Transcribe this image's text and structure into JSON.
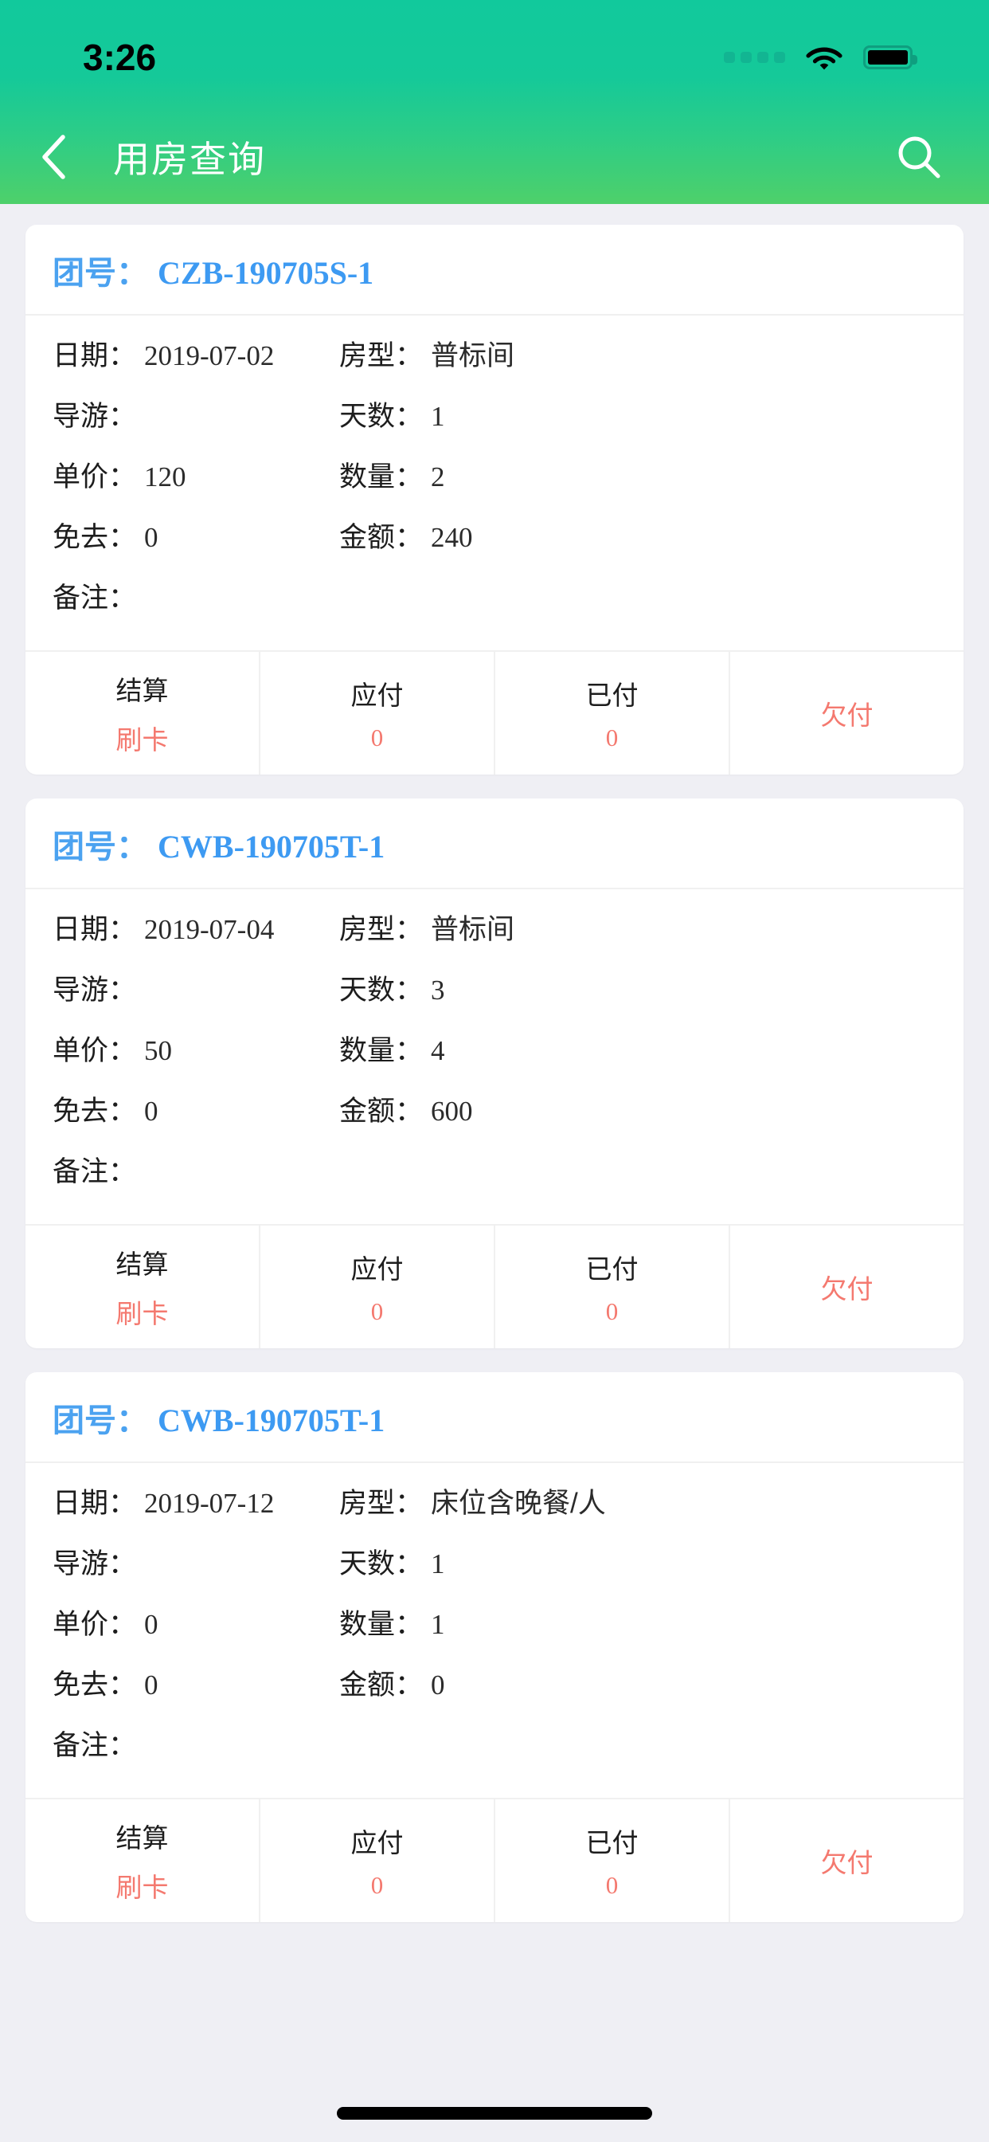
{
  "status_bar": {
    "time": "3:26",
    "signal_icon": "signal-dots-icon",
    "wifi_icon": "wifi-icon",
    "battery_icon": "battery-full-icon"
  },
  "nav": {
    "back_icon": "chevron-left-icon",
    "title": "用房查询",
    "search_icon": "search-icon"
  },
  "theme": {
    "header_gradient_start": "#11c99c",
    "header_gradient_end": "#4ed06a",
    "page_background": "#efeff4",
    "card_background": "#ffffff",
    "group_no_color": "#4ba2f0",
    "accent_red": "#f4796f",
    "text_primary": "#1d1d1d",
    "divider": "#f0f0f0"
  },
  "labels": {
    "group_no": "团号：",
    "date": "日期：",
    "room_type": "房型：",
    "guide": "导游：",
    "days": "天数：",
    "unit_price": "单价：",
    "quantity": "数量：",
    "waived": "免去：",
    "amount": "金额：",
    "remark": "备注：",
    "settlement": "结算",
    "payable": "应付",
    "paid": "已付",
    "unpaid": "欠付"
  },
  "cards": [
    {
      "group_no": "CZB-190705S-1",
      "date": "2019-07-02",
      "room_type": "普标间",
      "guide": "",
      "days": "1",
      "unit_price": "120",
      "quantity": "2",
      "waived": "0",
      "amount": "240",
      "remark": "",
      "settlement_value": "刷卡",
      "payable_value": "0",
      "paid_value": "0",
      "unpaid_value": ""
    },
    {
      "group_no": "CWB-190705T-1",
      "date": "2019-07-04",
      "room_type": "普标间",
      "guide": "",
      "days": "3",
      "unit_price": "50",
      "quantity": "4",
      "waived": "0",
      "amount": "600",
      "remark": "",
      "settlement_value": "刷卡",
      "payable_value": "0",
      "paid_value": "0",
      "unpaid_value": ""
    },
    {
      "group_no": "CWB-190705T-1",
      "date": "2019-07-12",
      "room_type": "床位含晚餐/人",
      "guide": "",
      "days": "1",
      "unit_price": "0",
      "quantity": "1",
      "waived": "0",
      "amount": "0",
      "remark": "",
      "settlement_value": "刷卡",
      "payable_value": "0",
      "paid_value": "0",
      "unpaid_value": ""
    }
  ]
}
